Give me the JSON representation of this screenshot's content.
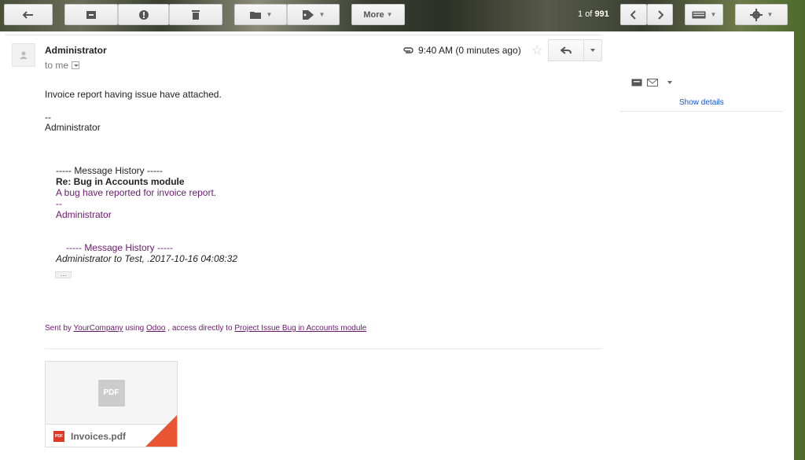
{
  "toolbar": {
    "more_label": "More",
    "counter_pos": "1",
    "counter_of": "of",
    "counter_total": "991"
  },
  "message": {
    "sender": "Administrator",
    "recipient": "to me",
    "time": "9:40 AM (0 minutes ago)",
    "body_line1": "Invoice report having issue have attached.",
    "sig_dash": "--",
    "sig_name": "Administrator"
  },
  "history": {
    "header": "----- Message History -----",
    "subject": "Re: Bug in Accounts module",
    "line": "A bug have reported for invoice report.",
    "dash": "--",
    "name": "Administrator",
    "header2": "----- Message History -----",
    "meta": "Administrator to Test, .2017-10-16 04:08:32",
    "ellipsis": "..."
  },
  "footer": {
    "sent_by": "Sent by",
    "company": "YourCompany",
    "using": "using",
    "odoo": "Odoo",
    "access": ", access directly to",
    "link": "Project Issue Bug in Accounts module"
  },
  "attachment": {
    "thumb_label": "PDF",
    "icon_label": "PDF",
    "filename": "Invoices.pdf"
  },
  "side": {
    "show_details": "Show details"
  }
}
